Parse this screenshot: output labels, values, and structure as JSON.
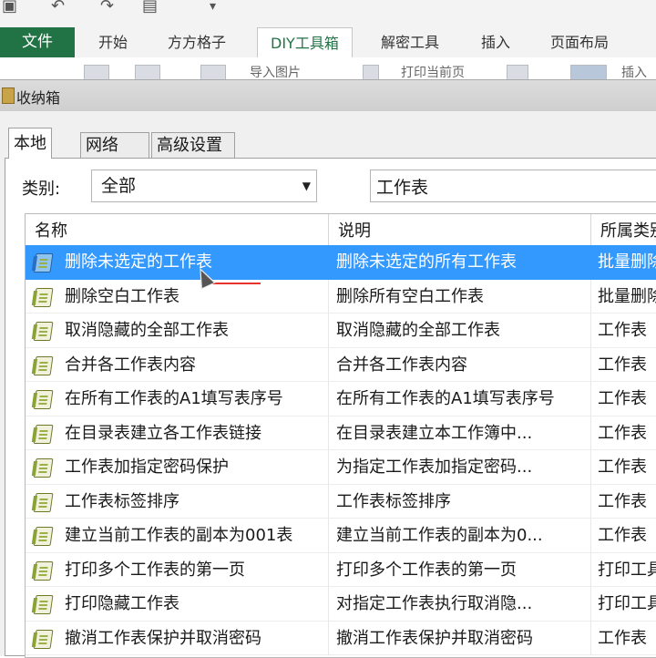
{
  "ribbon": {
    "tabs": [
      "开始",
      "方方格子",
      "DIY工具箱",
      "解密工具",
      "插入",
      "页面布局"
    ],
    "file_tab": "文件",
    "active_tab": "DIY工具箱",
    "partial_buttons": [
      "导入图片",
      "打印当前页",
      "插入"
    ]
  },
  "dialog": {
    "title": "收纳箱",
    "tabs": [
      "本地",
      "网络",
      "高级设置"
    ],
    "category_label": "类别:",
    "category_value": "全部",
    "search_value": "工作表",
    "columns": [
      "名称",
      "说明",
      "所属类别"
    ],
    "rows": [
      {
        "name": "删除未选定的工作表",
        "desc": "删除未选定的所有工作表",
        "cat": "批量删除"
      },
      {
        "name": "删除空白工作表",
        "desc": "删除所有空白工作表",
        "cat": "批量删除"
      },
      {
        "name": "取消隐藏的全部工作表",
        "desc": "取消隐藏的全部工作表",
        "cat": "工作表"
      },
      {
        "name": "合并各工作表内容",
        "desc": "合并各工作表内容",
        "cat": "工作表"
      },
      {
        "name": "在所有工作表的A1填写表序号",
        "desc": "在所有工作表的A1填写表序号",
        "cat": "工作表"
      },
      {
        "name": "在目录表建立各工作表链接",
        "desc": "在目录表建立本工作簿中...",
        "cat": "工作表"
      },
      {
        "name": "工作表加指定密码保护",
        "desc": "为指定工作表加指定密码...",
        "cat": "工作表"
      },
      {
        "name": "工作表标签排序",
        "desc": "工作表标签排序",
        "cat": "工作表"
      },
      {
        "name": "建立当前工作表的副本为001表",
        "desc": "建立当前工作表的副本为0...",
        "cat": "工作表"
      },
      {
        "name": "打印多个工作表的第一页",
        "desc": "打印多个工作表的第一页",
        "cat": "打印工具"
      },
      {
        "name": "打印隐藏工作表",
        "desc": "对指定工作表执行取消隐...",
        "cat": "打印工具"
      },
      {
        "name": "撤消工作表保护并取消密码",
        "desc": "撤消工作表保护并取消密码",
        "cat": "工作表"
      }
    ],
    "selected_index": 0
  }
}
